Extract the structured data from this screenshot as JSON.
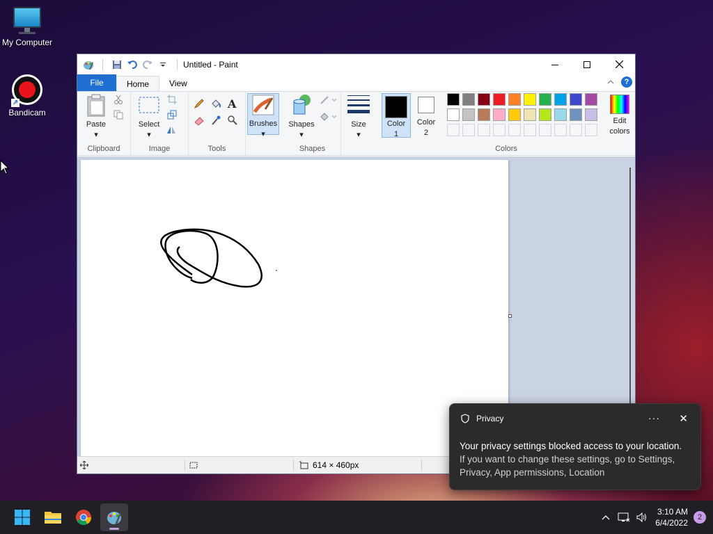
{
  "desktop": {
    "icons": [
      {
        "label": "My Computer"
      },
      {
        "label": "Bandicam"
      }
    ]
  },
  "paint": {
    "title": "Untitled - Paint",
    "tabs": {
      "file": "File",
      "home": "Home",
      "view": "View"
    },
    "ribbon": {
      "clipboard": {
        "paste": "Paste",
        "label": "Clipboard"
      },
      "image": {
        "select": "Select",
        "label": "Image"
      },
      "tools": {
        "label": "Tools"
      },
      "brushes": "Brushes",
      "shapes": {
        "button": "Shapes",
        "label": "Shapes"
      },
      "size": "Size",
      "color1": {
        "line1": "Color",
        "line2": "1"
      },
      "color2": {
        "line1": "Color",
        "line2": "2"
      },
      "edit_colors": {
        "line1": "Edit",
        "line2": "colors"
      },
      "colors_label": "Colors",
      "color1_value": "#000000",
      "color2_value": "#ffffff",
      "palette_row1": [
        "#000000",
        "#7f7f7f",
        "#880015",
        "#ed1c24",
        "#ff7f27",
        "#fff200",
        "#22b14c",
        "#00a2e8",
        "#3f48cc",
        "#a349a4"
      ],
      "palette_row2": [
        "#ffffff",
        "#c3c3c3",
        "#b97a57",
        "#ffaec9",
        "#ffc90e",
        "#efe4b0",
        "#b5e61d",
        "#99d9ea",
        "#7092be",
        "#c8bfe7"
      ],
      "palette_row3": [
        "#f5f6f7",
        "#f5f6f7",
        "#f5f6f7",
        "#f5f6f7",
        "#f5f6f7",
        "#f5f6f7",
        "#f5f6f7",
        "#f5f6f7",
        "#f5f6f7",
        "#f5f6f7"
      ]
    },
    "status": {
      "dimensions": "614 × 460px"
    }
  },
  "toast": {
    "app": "Privacy",
    "line1": "Your privacy settings blocked access to your location.",
    "line2": "If you want to change these settings, go to Settings, Privacy, App permissions, Location"
  },
  "taskbar": {
    "time": "3:10 AM",
    "date": "6/4/2022",
    "notifications": "2"
  }
}
